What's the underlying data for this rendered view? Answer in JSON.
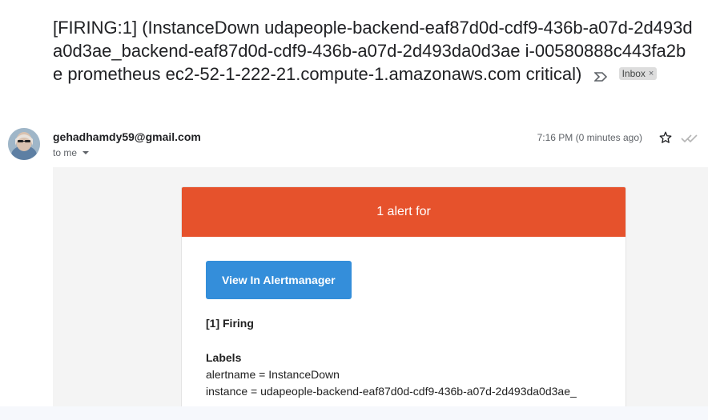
{
  "email": {
    "subject": "[FIRING:1] (InstanceDown udapeople-backend-eaf87d0d-cdf9-436b-a07d-2d493da0d3ae_backend-eaf87d0d-cdf9-436b-a07d-2d493da0d3ae i-00580888c443fa2be prometheus ec2-52-1-222-21.compute-1.amazonaws.com critical)",
    "label_chip": "Inbox",
    "label_chip_close": "×",
    "sender": "gehadhamdy59@gmail.com",
    "recipient": "to me",
    "timestamp": "7:16 PM (0 minutes ago)"
  },
  "alert": {
    "header": "1 alert for",
    "button_label": "View In Alertmanager",
    "firing_title": "[1] Firing",
    "labels_title": "Labels",
    "labels": [
      "alertname = InstanceDown",
      "instance = udapeople-backend-eaf87d0d-cdf9-436b-a07d-2d493da0d3ae_"
    ]
  },
  "colors": {
    "alert_header": "#e6522c",
    "button": "#348eda"
  },
  "icons": [
    "important-marker-icon",
    "star-icon",
    "seen-checkmark-icon",
    "chevron-down-icon"
  ]
}
